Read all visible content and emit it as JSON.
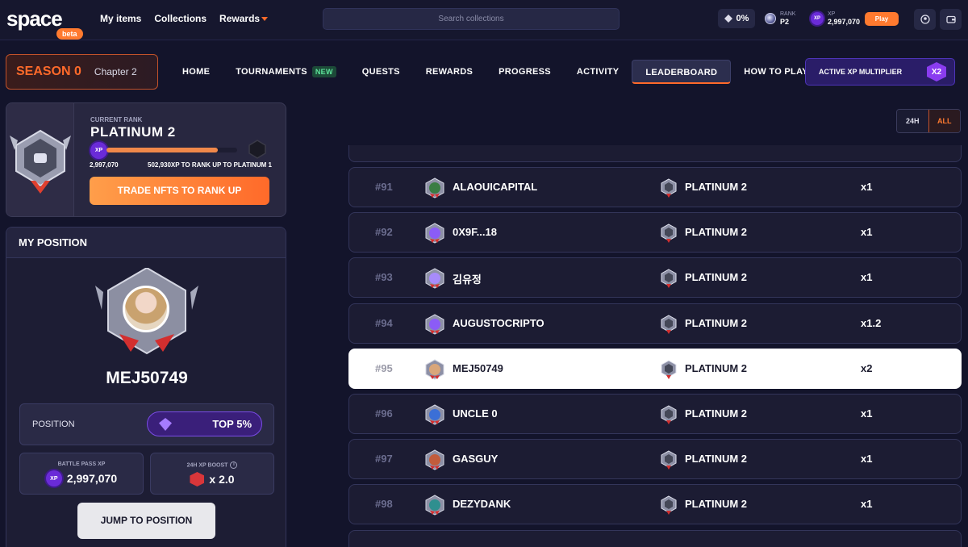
{
  "topbar": {
    "logo": "space",
    "beta": "beta",
    "nav": [
      "My items",
      "Collections",
      "Rewards"
    ],
    "search_placeholder": "Search collections",
    "percent": "0%",
    "rank_label": "RANK",
    "rank_value": "P2",
    "xp_label": "XP",
    "xp_value": "2,997,070",
    "play": "Play"
  },
  "season": {
    "title": "SEASON 0",
    "chapter": "Chapter 2"
  },
  "main_nav": {
    "items": [
      "HOME",
      "TOURNAMENTS",
      "QUESTS",
      "REWARDS",
      "PROGRESS",
      "ACTIVITY",
      "LEADERBOARD",
      "HOW TO PLAY"
    ],
    "new_tag": "NEW",
    "active": "LEADERBOARD"
  },
  "multiplier": {
    "label": "ACTIVE XP MULTIPLIER",
    "value": "X2"
  },
  "rank_card": {
    "label": "CURRENT RANK",
    "rank": "PLATINUM 2",
    "xp": "2,997,070",
    "needed": "502,930XP TO RANK UP TO PLATINUM 1",
    "progress": 0.85,
    "button": "TRADE NFTS TO RANK UP"
  },
  "my_position": {
    "title": "MY POSITION",
    "username": "MEJ50749",
    "position_label": "POSITION",
    "position_value": "TOP 5%",
    "battle_pass_label": "BATTLE PASS XP",
    "battle_pass_value": "2,997,070",
    "boost_label": "24H XP BOOST",
    "boost_value": "x 2.0",
    "jump": "JUMP TO POSITION"
  },
  "toggle": {
    "a": "24H",
    "b": "ALL"
  },
  "leaderboard": {
    "rows": [
      {
        "rank": "#91",
        "name": "ALAOUICAPITAL",
        "tier": "PLATINUM 2",
        "mult": "x1",
        "avatar_color": "#3a7d44"
      },
      {
        "rank": "#92",
        "name": "0X9F...18",
        "tier": "PLATINUM 2",
        "mult": "x1",
        "avatar_color": "#8b5cf6"
      },
      {
        "rank": "#93",
        "name": "김유정",
        "tier": "PLATINUM 2",
        "mult": "x1",
        "avatar_color": "#a78bfa"
      },
      {
        "rank": "#94",
        "name": "AUGUSTOCRIPTO",
        "tier": "PLATINUM 2",
        "mult": "x1.2",
        "avatar_color": "#8b5cf6"
      },
      {
        "rank": "#95",
        "name": "MEJ50749",
        "tier": "PLATINUM 2",
        "mult": "x2",
        "avatar_color": "#d9a67a",
        "me": true
      },
      {
        "rank": "#96",
        "name": "UNCLE 0",
        "tier": "PLATINUM 2",
        "mult": "x1",
        "avatar_color": "#3b6fd6"
      },
      {
        "rank": "#97",
        "name": "GASGUY",
        "tier": "PLATINUM 2",
        "mult": "x1",
        "avatar_color": "#c25c3c"
      },
      {
        "rank": "#98",
        "name": "DEZYDANK",
        "tier": "PLATINUM 2",
        "mult": "x1",
        "avatar_color": "#2f8f8f"
      }
    ]
  }
}
